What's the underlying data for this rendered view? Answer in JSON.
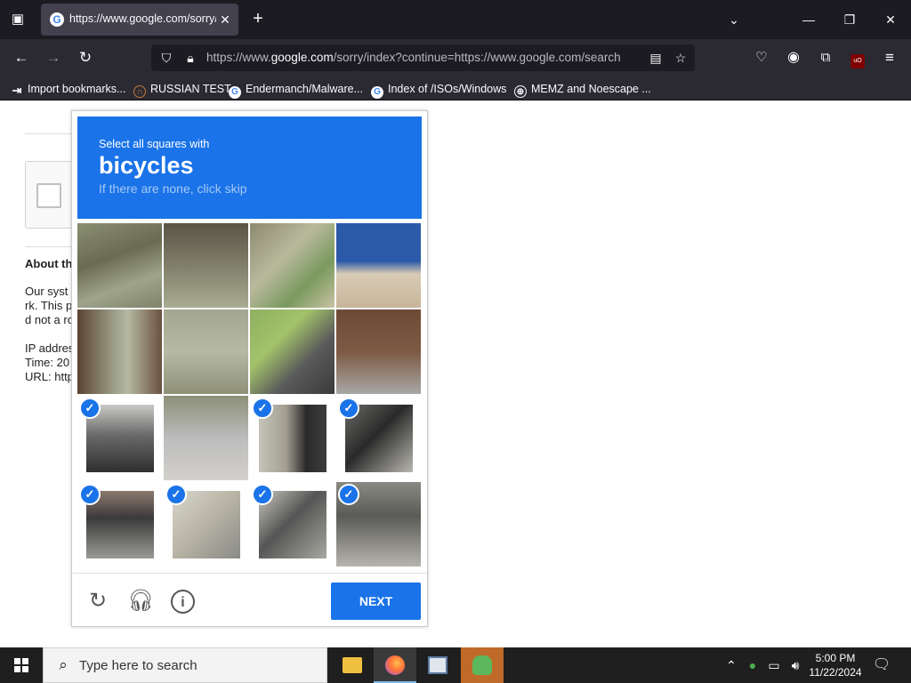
{
  "browser": {
    "tab_title": "https://www.google.com/sorry/index?continue",
    "url_prefix": "https://www.",
    "url_domain": "google.com",
    "url_suffix": "/sorry/index?continue=https://www.google.com/search",
    "bookmarks": [
      {
        "label": "Import bookmarks...",
        "icon": "import-icon"
      },
      {
        "label": "RUSSIAN TEST",
        "icon": "horseshoe-icon"
      },
      {
        "label": "Endermanch/Malware...",
        "icon": "google-icon"
      },
      {
        "label": "Index of /ISOs/Windows",
        "icon": "google-icon"
      },
      {
        "label": "MEMZ and Noescape ...",
        "icon": "globe-icon"
      }
    ]
  },
  "page": {
    "about_heading": "About th",
    "about_lines": [
      "Our syst",
      "rk. This p",
      "d not a ro"
    ],
    "ip_line": "IP addres",
    "time_line": "Time: 20",
    "url_line": "URL: http"
  },
  "captcha": {
    "instruction": "Select all squares with",
    "target": "bicycles",
    "hint": "If there are none, click skip",
    "next_label": "NEXT"
  },
  "taskbar": {
    "search_placeholder": "Type here to search",
    "time": "5:00 PM",
    "date": "11/22/2024"
  },
  "colors": {
    "accent": "#1a73e8",
    "chrome_dark": "#1c1b22",
    "chrome_mid": "#2b2a33"
  }
}
